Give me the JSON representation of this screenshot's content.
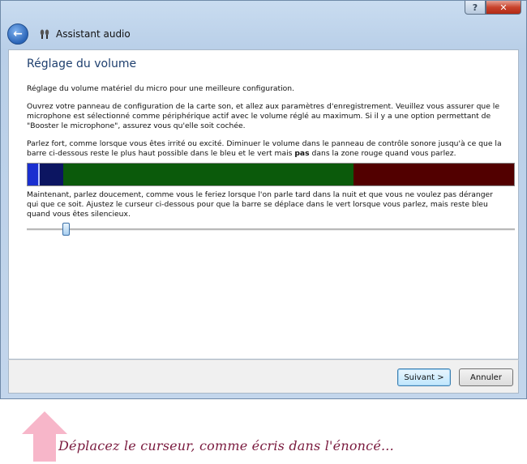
{
  "window": {
    "title": "Assistant audio",
    "help_label": "?",
    "close_label": "✕"
  },
  "page": {
    "heading": "Réglage du volume",
    "intro": "Réglage du volume matériel du micro pour une meilleure configuration.",
    "instructions": "Ouvrez votre panneau de configuration de la carte son, et allez aux paramètres d'enregistrement. Veuillez vous assurer que le microphone est sélectionné comme périphérique actif avec le volume réglé au maximum. Si il y a une option permettant de \"Booster le microphone\", assurez vous qu'elle soit cochée.",
    "loud_text_before": "Parlez fort, comme lorsque vous êtes irrité ou excité. Diminuer le volume dans le panneau de contrôle sonore jusqu'à ce que la barre ci-dessous reste le plus haut possible dans le bleu et le vert mais ",
    "loud_text_bold": "pas",
    "loud_text_after": " dans la zone rouge quand vous parlez.",
    "soft_text": "Maintenant, parlez doucement, comme vous le feriez lorsque l'on parle tard dans la nuit et que vous ne voulez pas déranger qui que ce soit. Ajustez le curseur ci-dessous pour que la barre se déplace dans le vert lorsque vous parlez, mais reste bleu quand vous êtes silencieux."
  },
  "meter": {
    "colors": {
      "blue_bright": "#1a2fd0",
      "blue_dark": "#0c1561",
      "green": "#0b5a0b",
      "red": "#520000"
    }
  },
  "slider": {
    "level_fraction": 0.08
  },
  "footer": {
    "next_label": "Suivant >",
    "cancel_label": "Annuler"
  },
  "annotation": {
    "text": "Déplacez le curseur, comme écris dans l'énoncé...",
    "color": "#7a1a3e",
    "arrow_color": "#f7b6c9"
  }
}
